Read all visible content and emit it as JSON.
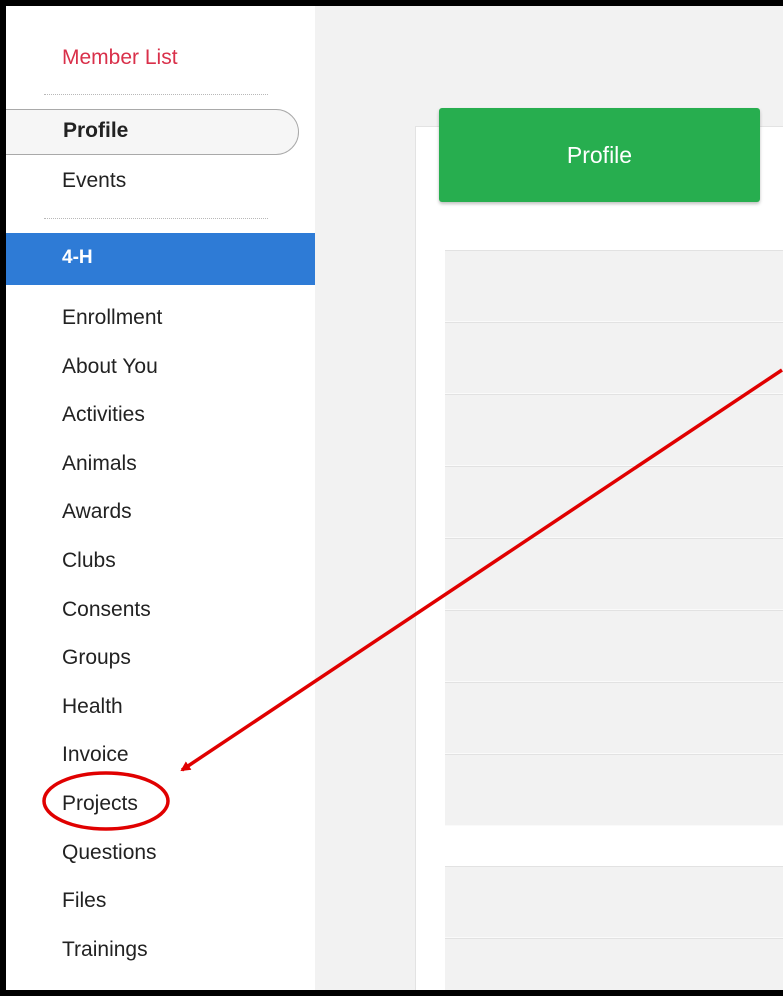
{
  "sidebar": {
    "member_list": "Member List",
    "profile": "Profile",
    "events": "Events",
    "section_header": "4-H",
    "items": [
      {
        "label": "Enrollment"
      },
      {
        "label": "About You"
      },
      {
        "label": "Activities"
      },
      {
        "label": "Animals"
      },
      {
        "label": "Awards"
      },
      {
        "label": "Clubs"
      },
      {
        "label": "Consents"
      },
      {
        "label": "Groups"
      },
      {
        "label": "Health"
      },
      {
        "label": "Invoice"
      },
      {
        "label": "Projects"
      },
      {
        "label": "Questions"
      },
      {
        "label": "Files"
      },
      {
        "label": "Trainings"
      }
    ]
  },
  "main": {
    "profile_button": "Profile"
  },
  "colors": {
    "member_list": "#d9304a",
    "section_header": "#2e7bd6",
    "profile_button": "#27ae4f",
    "annotation": "#e00000"
  }
}
